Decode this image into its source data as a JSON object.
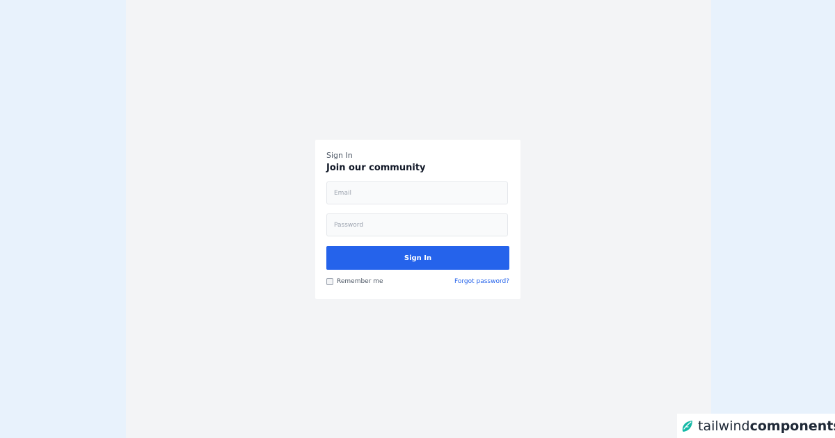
{
  "card": {
    "eyebrow": "Sign In",
    "title": "Join our community"
  },
  "form": {
    "email": {
      "placeholder": "Email",
      "value": ""
    },
    "password": {
      "placeholder": "Password",
      "value": ""
    },
    "submit_label": "Sign In",
    "remember_label": "Remember me",
    "forgot_label": "Forgot password?"
  },
  "brand": {
    "name_regular": "tailwind",
    "name_bold": "components",
    "icon": "tailwind-leaf-icon"
  },
  "colors": {
    "accent": "#2563eb",
    "page_background": "#f3f4f6",
    "outer_background": "#e8f2fc",
    "brand_teal": "#14b8a6"
  }
}
